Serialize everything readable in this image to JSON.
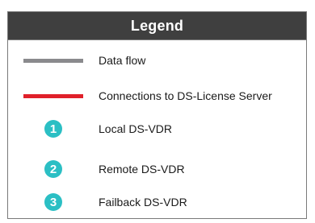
{
  "legend": {
    "title": "Legend",
    "lines": [
      {
        "label": "Data flow",
        "color": "#8a8a8d"
      },
      {
        "label": "Connections to DS-License Server",
        "color": "#e0202a"
      }
    ],
    "numbered_items": [
      {
        "number": "1",
        "label": "Local DS-VDR",
        "color": "#2bbfc4"
      },
      {
        "number": "2",
        "label": "Remote DS-VDR",
        "color": "#2bbfc4"
      },
      {
        "number": "3",
        "label": "Failback DS-VDR",
        "color": "#2bbfc4"
      }
    ]
  }
}
